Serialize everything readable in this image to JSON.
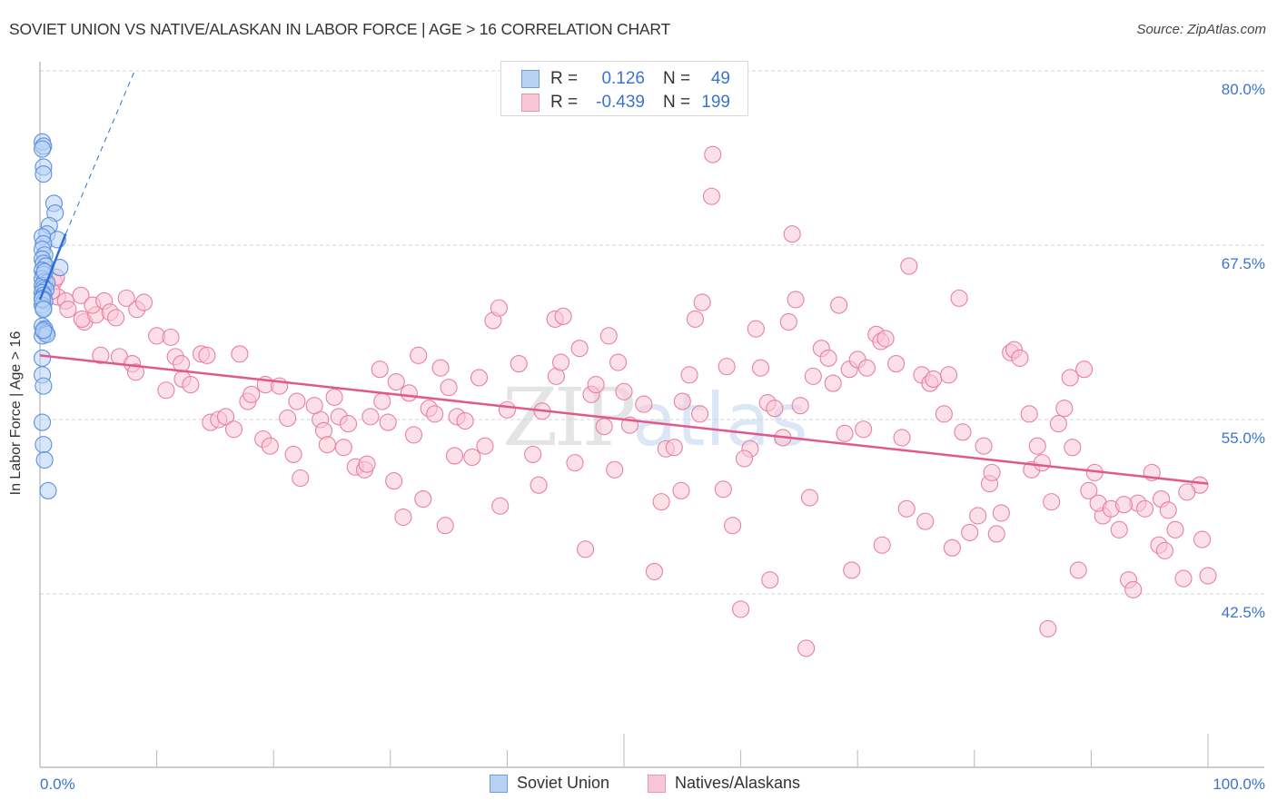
{
  "header": {
    "title": "SOVIET UNION VS NATIVE/ALASKAN IN LABOR FORCE | AGE > 16 CORRELATION CHART",
    "source": "Source: ZipAtlas.com"
  },
  "watermark": {
    "zip": "ZIP",
    "atlas": "atlas"
  },
  "legend": {
    "r_label": "R =",
    "n_label": "N =",
    "rows": [
      {
        "name": "Soviet Union",
        "r": "0.126",
        "n": "49"
      },
      {
        "name": "Natives/Alaskans",
        "r": "-0.439",
        "n": "199"
      }
    ]
  },
  "colors": {
    "blue_fill": "#b8d2f4",
    "blue_stroke": "#5b8fe0",
    "blue_line": "#2f6fd6",
    "pink_fill": "#f9c6d5",
    "pink_stroke": "#e880a3",
    "pink_line": "#e2588a",
    "tick_text": "#3b74d0"
  },
  "chart_data": {
    "type": "scatter",
    "title": "SOVIET UNION VS NATIVE/ALASKAN IN LABOR FORCE | AGE > 16 CORRELATION CHART",
    "xlabel": "",
    "ylabel": "In Labor Force | Age > 16",
    "xlim": [
      0,
      100
    ],
    "ylim": [
      30,
      81.2
    ],
    "x_tick_labels": [
      "0.0%",
      "100.0%"
    ],
    "x_ticks": [
      0,
      10,
      20,
      30,
      40,
      50,
      60,
      70,
      80,
      90,
      100
    ],
    "y_ticks": [
      42.5,
      55.0,
      67.5,
      80.0
    ],
    "y_tick_labels": [
      "42.5%",
      "55.0%",
      "67.5%",
      "80.0%"
    ],
    "grid": true,
    "legend_position": "bottom-center",
    "series": [
      {
        "name": "Soviet Union",
        "r": 0.126,
        "n": 49,
        "trend": {
          "x": [
            0,
            2.2
          ],
          "y": [
            63.6,
            68.3
          ]
        },
        "trend_extension": {
          "x": [
            2.2,
            8.1
          ],
          "y": [
            68.3,
            80.0
          ]
        },
        "points": [
          [
            0.2,
            74.9
          ],
          [
            0.3,
            74.6
          ],
          [
            0.2,
            74.4
          ],
          [
            0.3,
            73.1
          ],
          [
            0.3,
            72.6
          ],
          [
            1.2,
            70.5
          ],
          [
            1.3,
            69.8
          ],
          [
            0.8,
            68.9
          ],
          [
            0.6,
            68.3
          ],
          [
            1.5,
            67.9
          ],
          [
            0.2,
            68.1
          ],
          [
            0.3,
            67.6
          ],
          [
            0.2,
            67.2
          ],
          [
            0.4,
            66.8
          ],
          [
            0.2,
            66.5
          ],
          [
            0.3,
            66.2
          ],
          [
            0.5,
            66.0
          ],
          [
            1.7,
            65.9
          ],
          [
            0.2,
            65.7
          ],
          [
            0.3,
            65.4
          ],
          [
            0.2,
            65.1
          ],
          [
            0.4,
            64.9
          ],
          [
            0.6,
            64.8
          ],
          [
            0.2,
            64.6
          ],
          [
            0.3,
            64.4
          ],
          [
            0.5,
            64.3
          ],
          [
            0.2,
            64.1
          ],
          [
            0.3,
            63.9
          ],
          [
            0.2,
            63.7
          ],
          [
            0.4,
            63.5
          ],
          [
            0.2,
            63.2
          ],
          [
            0.3,
            63.0
          ],
          [
            0.2,
            61.7
          ],
          [
            0.4,
            61.5
          ],
          [
            0.3,
            61.3
          ],
          [
            0.5,
            61.2
          ],
          [
            0.2,
            61.0
          ],
          [
            0.6,
            61.1
          ],
          [
            0.3,
            61.4
          ],
          [
            0.2,
            59.4
          ],
          [
            0.2,
            58.2
          ],
          [
            0.3,
            57.4
          ],
          [
            0.2,
            54.8
          ],
          [
            0.3,
            53.2
          ],
          [
            0.4,
            52.1
          ],
          [
            0.7,
            49.9
          ],
          [
            0.2,
            63.6
          ],
          [
            0.4,
            65.6
          ],
          [
            0.3,
            62.9
          ]
        ]
      },
      {
        "name": "Natives/Alaskans",
        "r": -0.439,
        "n": 199,
        "trend": {
          "x": [
            0,
            100
          ],
          "y": [
            59.6,
            50.4
          ]
        },
        "points": [
          [
            1.2,
            64.9
          ],
          [
            1.5,
            63.8
          ],
          [
            1.0,
            64.2
          ],
          [
            1.4,
            65.2
          ],
          [
            2.2,
            63.5
          ],
          [
            2.4,
            62.9
          ],
          [
            3.5,
            63.9
          ],
          [
            3.8,
            62.0
          ],
          [
            3.6,
            62.2
          ],
          [
            4.8,
            62.5
          ],
          [
            4.5,
            63.2
          ],
          [
            5.5,
            63.5
          ],
          [
            6.0,
            62.7
          ],
          [
            6.5,
            62.3
          ],
          [
            7.4,
            63.7
          ],
          [
            8.3,
            62.9
          ],
          [
            8.9,
            63.4
          ],
          [
            5.2,
            59.6
          ],
          [
            6.8,
            59.5
          ],
          [
            7.9,
            59.0
          ],
          [
            8.2,
            58.4
          ],
          [
            10.0,
            61.0
          ],
          [
            11.2,
            60.9
          ],
          [
            11.6,
            59.5
          ],
          [
            12.2,
            57.9
          ],
          [
            12.9,
            57.5
          ],
          [
            10.8,
            57.1
          ],
          [
            12.1,
            59.0
          ],
          [
            13.8,
            59.7
          ],
          [
            14.3,
            59.6
          ],
          [
            17.1,
            59.7
          ],
          [
            14.6,
            54.8
          ],
          [
            15.3,
            55.0
          ],
          [
            15.9,
            55.2
          ],
          [
            16.6,
            54.3
          ],
          [
            17.8,
            56.3
          ],
          [
            18.1,
            56.8
          ],
          [
            19.1,
            53.6
          ],
          [
            19.7,
            53.1
          ],
          [
            19.3,
            57.5
          ],
          [
            20.5,
            57.4
          ],
          [
            21.2,
            55.1
          ],
          [
            21.7,
            52.5
          ],
          [
            22.3,
            50.8
          ],
          [
            22.0,
            56.3
          ],
          [
            24.0,
            55.0
          ],
          [
            23.5,
            56.0
          ],
          [
            24.3,
            54.2
          ],
          [
            24.6,
            53.2
          ],
          [
            25.2,
            56.6
          ],
          [
            25.6,
            55.2
          ],
          [
            26.4,
            54.7
          ],
          [
            26.0,
            53.0
          ],
          [
            27.0,
            51.6
          ],
          [
            27.8,
            51.4
          ],
          [
            28.0,
            51.8
          ],
          [
            28.3,
            55.2
          ],
          [
            29.1,
            58.6
          ],
          [
            29.3,
            56.3
          ],
          [
            29.8,
            54.8
          ],
          [
            30.3,
            50.6
          ],
          [
            30.5,
            57.7
          ],
          [
            31.1,
            48.0
          ],
          [
            31.6,
            56.9
          ],
          [
            32.0,
            53.9
          ],
          [
            32.4,
            59.6
          ],
          [
            32.8,
            49.3
          ],
          [
            33.3,
            55.8
          ],
          [
            33.8,
            55.4
          ],
          [
            34.3,
            58.7
          ],
          [
            34.7,
            47.4
          ],
          [
            35.0,
            57.3
          ],
          [
            35.7,
            55.2
          ],
          [
            36.4,
            54.9
          ],
          [
            35.5,
            52.4
          ],
          [
            37.0,
            52.3
          ],
          [
            37.6,
            58.0
          ],
          [
            38.1,
            53.1
          ],
          [
            38.8,
            62.1
          ],
          [
            39.3,
            63.0
          ],
          [
            40.0,
            55.7
          ],
          [
            39.4,
            48.8
          ],
          [
            41.0,
            59.0
          ],
          [
            42.2,
            52.5
          ],
          [
            42.7,
            50.3
          ],
          [
            43.0,
            55.6
          ],
          [
            44.1,
            62.2
          ],
          [
            44.8,
            62.4
          ],
          [
            44.2,
            58.1
          ],
          [
            44.6,
            59.1
          ],
          [
            45.8,
            51.9
          ],
          [
            46.2,
            60.1
          ],
          [
            46.7,
            45.7
          ],
          [
            47.2,
            56.8
          ],
          [
            47.6,
            57.5
          ],
          [
            48.3,
            54.5
          ],
          [
            48.7,
            61.0
          ],
          [
            49.5,
            59.1
          ],
          [
            50.0,
            57.0
          ],
          [
            49.2,
            51.4
          ],
          [
            50.5,
            54.6
          ],
          [
            51.7,
            56.1
          ],
          [
            52.6,
            44.1
          ],
          [
            53.2,
            49.1
          ],
          [
            53.6,
            52.9
          ],
          [
            54.3,
            53.0
          ],
          [
            54.9,
            49.9
          ],
          [
            55.6,
            58.2
          ],
          [
            55.0,
            56.3
          ],
          [
            56.1,
            62.2
          ],
          [
            56.7,
            63.4
          ],
          [
            56.5,
            55.4
          ],
          [
            57.5,
            71.0
          ],
          [
            57.6,
            74.0
          ],
          [
            58.5,
            50.0
          ],
          [
            58.8,
            58.8
          ],
          [
            59.3,
            47.4
          ],
          [
            60.0,
            41.4
          ],
          [
            60.8,
            52.9
          ],
          [
            61.3,
            61.5
          ],
          [
            61.7,
            58.7
          ],
          [
            62.3,
            56.2
          ],
          [
            62.9,
            55.8
          ],
          [
            62.5,
            43.5
          ],
          [
            63.6,
            53.7
          ],
          [
            64.1,
            62.0
          ],
          [
            64.4,
            68.3
          ],
          [
            64.7,
            63.6
          ],
          [
            65.1,
            56.0
          ],
          [
            65.6,
            38.6
          ],
          [
            65.9,
            49.4
          ],
          [
            66.2,
            58.1
          ],
          [
            66.9,
            60.1
          ],
          [
            67.5,
            59.4
          ],
          [
            67.9,
            57.6
          ],
          [
            68.4,
            63.2
          ],
          [
            68.9,
            54.0
          ],
          [
            69.3,
            58.6
          ],
          [
            69.5,
            44.2
          ],
          [
            70.0,
            59.3
          ],
          [
            70.5,
            54.3
          ],
          [
            70.8,
            58.7
          ],
          [
            71.6,
            61.1
          ],
          [
            72.0,
            60.6
          ],
          [
            72.4,
            60.8
          ],
          [
            72.1,
            46.0
          ],
          [
            73.3,
            59.0
          ],
          [
            73.8,
            53.7
          ],
          [
            74.2,
            48.6
          ],
          [
            74.4,
            66.0
          ],
          [
            75.5,
            58.2
          ],
          [
            75.8,
            47.7
          ],
          [
            76.2,
            57.6
          ],
          [
            76.5,
            57.9
          ],
          [
            77.4,
            55.4
          ],
          [
            77.8,
            58.2
          ],
          [
            78.1,
            45.8
          ],
          [
            78.7,
            63.7
          ],
          [
            79.0,
            54.1
          ],
          [
            79.6,
            46.9
          ],
          [
            80.3,
            48.1
          ],
          [
            80.8,
            53.1
          ],
          [
            81.3,
            50.4
          ],
          [
            81.5,
            51.2
          ],
          [
            81.9,
            46.8
          ],
          [
            82.3,
            48.3
          ],
          [
            83.1,
            59.8
          ],
          [
            83.4,
            60.0
          ],
          [
            83.9,
            59.4
          ],
          [
            84.7,
            55.4
          ],
          [
            84.9,
            51.4
          ],
          [
            85.4,
            53.1
          ],
          [
            85.8,
            51.9
          ],
          [
            86.3,
            40.0
          ],
          [
            86.6,
            49.1
          ],
          [
            87.2,
            54.7
          ],
          [
            87.7,
            55.8
          ],
          [
            88.2,
            58.0
          ],
          [
            88.9,
            44.2
          ],
          [
            89.4,
            58.6
          ],
          [
            89.8,
            49.9
          ],
          [
            90.3,
            51.2
          ],
          [
            91.0,
            48.1
          ],
          [
            90.6,
            49.0
          ],
          [
            91.7,
            48.6
          ],
          [
            92.4,
            47.1
          ],
          [
            93.2,
            43.5
          ],
          [
            93.6,
            42.8
          ],
          [
            94.0,
            49.0
          ],
          [
            94.6,
            48.6
          ],
          [
            95.2,
            51.2
          ],
          [
            95.8,
            46.0
          ],
          [
            96.3,
            45.6
          ],
          [
            96.0,
            49.3
          ],
          [
            96.6,
            48.5
          ],
          [
            97.2,
            47.1
          ],
          [
            97.9,
            43.6
          ],
          [
            99.3,
            50.3
          ],
          [
            99.5,
            46.4
          ],
          [
            100.0,
            43.8
          ],
          [
            98.2,
            49.8
          ],
          [
            92.8,
            48.9
          ],
          [
            88.4,
            53.0
          ],
          [
            60.3,
            52.2
          ]
        ]
      }
    ]
  },
  "bottom_legend": {
    "items": [
      {
        "label": "Soviet Union"
      },
      {
        "label": "Natives/Alaskans"
      }
    ]
  }
}
